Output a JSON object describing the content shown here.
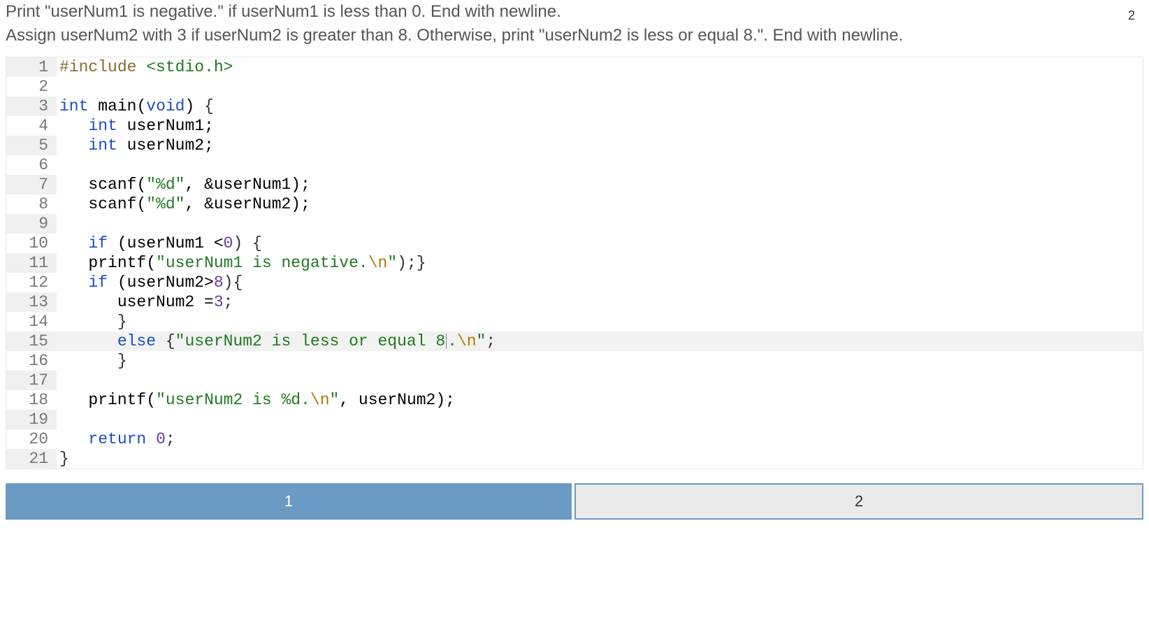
{
  "instructions": {
    "line1": "Print \"userNum1 is negative.\" if userNum1 is less than 0. End with newline.",
    "line2": "Assign userNum2 with 3 if userNum2 is greater than 8. Otherwise, print \"userNum2 is less or equal 8.\". End with newline."
  },
  "top_badge": "2",
  "code": {
    "lines": [
      {
        "n": "1",
        "shade": true,
        "highlight": false,
        "tokens": [
          {
            "t": "#include ",
            "c": "tok-preproc"
          },
          {
            "t": "<stdio.h>",
            "c": "tok-include"
          }
        ]
      },
      {
        "n": "2",
        "shade": false,
        "highlight": false,
        "tokens": []
      },
      {
        "n": "3",
        "shade": true,
        "highlight": false,
        "tokens": [
          {
            "t": "int",
            "c": "tok-type"
          },
          {
            "t": " ",
            "c": ""
          },
          {
            "t": "main",
            "c": "tok-func"
          },
          {
            "t": "(",
            "c": "tok-paren"
          },
          {
            "t": "void",
            "c": "tok-type"
          },
          {
            "t": ")",
            "c": "tok-paren"
          },
          {
            "t": " {",
            "c": "tok-op"
          }
        ]
      },
      {
        "n": "4",
        "shade": false,
        "highlight": false,
        "tokens": [
          {
            "t": "   ",
            "c": ""
          },
          {
            "t": "int",
            "c": "tok-type"
          },
          {
            "t": " userNum1;",
            "c": "tok-iden"
          }
        ]
      },
      {
        "n": "5",
        "shade": true,
        "highlight": false,
        "tokens": [
          {
            "t": "   ",
            "c": ""
          },
          {
            "t": "int",
            "c": "tok-type"
          },
          {
            "t": " userNum2;",
            "c": "tok-iden"
          }
        ]
      },
      {
        "n": "6",
        "shade": false,
        "highlight": false,
        "tokens": []
      },
      {
        "n": "7",
        "shade": true,
        "highlight": false,
        "tokens": [
          {
            "t": "   ",
            "c": ""
          },
          {
            "t": "scanf",
            "c": "tok-func"
          },
          {
            "t": "(",
            "c": "tok-paren"
          },
          {
            "t": "\"%d\"",
            "c": "tok-string"
          },
          {
            "t": ", &userNum1);",
            "c": "tok-iden"
          }
        ]
      },
      {
        "n": "8",
        "shade": false,
        "highlight": false,
        "tokens": [
          {
            "t": "   ",
            "c": ""
          },
          {
            "t": "scanf",
            "c": "tok-func"
          },
          {
            "t": "(",
            "c": "tok-paren"
          },
          {
            "t": "\"%d\"",
            "c": "tok-string"
          },
          {
            "t": ", &userNum2);",
            "c": "tok-iden"
          }
        ]
      },
      {
        "n": "9",
        "shade": true,
        "highlight": false,
        "tokens": []
      },
      {
        "n": "10",
        "shade": false,
        "highlight": false,
        "tokens": [
          {
            "t": "   ",
            "c": ""
          },
          {
            "t": "if",
            "c": "tok-keyword"
          },
          {
            "t": " (userNum1 <",
            "c": "tok-iden"
          },
          {
            "t": "0",
            "c": "tok-num"
          },
          {
            "t": ") {",
            "c": "tok-op"
          }
        ]
      },
      {
        "n": "11",
        "shade": true,
        "highlight": false,
        "tokens": [
          {
            "t": "   ",
            "c": ""
          },
          {
            "t": "printf",
            "c": "tok-func"
          },
          {
            "t": "(",
            "c": "tok-paren"
          },
          {
            "t": "\"userNum1 is negative.",
            "c": "tok-string"
          },
          {
            "t": "\\n",
            "c": "tok-esc"
          },
          {
            "t": "\"",
            "c": "tok-string"
          },
          {
            "t": ");}",
            "c": "tok-op"
          }
        ]
      },
      {
        "n": "12",
        "shade": false,
        "highlight": false,
        "tokens": [
          {
            "t": "   ",
            "c": ""
          },
          {
            "t": "if",
            "c": "tok-keyword"
          },
          {
            "t": " (userNum2>",
            "c": "tok-iden"
          },
          {
            "t": "8",
            "c": "tok-num"
          },
          {
            "t": "){",
            "c": "tok-op"
          }
        ]
      },
      {
        "n": "13",
        "shade": true,
        "highlight": false,
        "tokens": [
          {
            "t": "      userNum2 =",
            "c": "tok-iden"
          },
          {
            "t": "3",
            "c": "tok-num"
          },
          {
            "t": ";",
            "c": "tok-op"
          }
        ]
      },
      {
        "n": "14",
        "shade": false,
        "highlight": false,
        "tokens": [
          {
            "t": "      }",
            "c": "tok-op"
          }
        ]
      },
      {
        "n": "15",
        "shade": true,
        "highlight": true,
        "tokens": [
          {
            "t": "      ",
            "c": ""
          },
          {
            "t": "else",
            "c": "tok-keyword"
          },
          {
            "t": " {",
            "c": "tok-op"
          },
          {
            "t": "\"userNum2 is less or equal 8",
            "c": "tok-string"
          },
          {
            "cursor": true
          },
          {
            "t": ".",
            "c": "tok-string"
          },
          {
            "t": "\\n",
            "c": "tok-esc"
          },
          {
            "t": "\"",
            "c": "tok-string"
          },
          {
            "t": ";",
            "c": "tok-op"
          }
        ]
      },
      {
        "n": "16",
        "shade": false,
        "highlight": false,
        "tokens": [
          {
            "t": "      }",
            "c": "tok-op"
          }
        ]
      },
      {
        "n": "17",
        "shade": true,
        "highlight": false,
        "tokens": []
      },
      {
        "n": "18",
        "shade": false,
        "highlight": false,
        "tokens": [
          {
            "t": "   ",
            "c": ""
          },
          {
            "t": "printf",
            "c": "tok-func"
          },
          {
            "t": "(",
            "c": "tok-paren"
          },
          {
            "t": "\"userNum2 is %d.",
            "c": "tok-string"
          },
          {
            "t": "\\n",
            "c": "tok-esc"
          },
          {
            "t": "\"",
            "c": "tok-string"
          },
          {
            "t": ", userNum2);",
            "c": "tok-iden"
          }
        ]
      },
      {
        "n": "19",
        "shade": true,
        "highlight": false,
        "tokens": []
      },
      {
        "n": "20",
        "shade": false,
        "highlight": false,
        "tokens": [
          {
            "t": "   ",
            "c": ""
          },
          {
            "t": "return",
            "c": "tok-keyword"
          },
          {
            "t": " ",
            "c": ""
          },
          {
            "t": "0",
            "c": "tok-num"
          },
          {
            "t": ";",
            "c": "tok-op"
          }
        ]
      },
      {
        "n": "21",
        "shade": true,
        "highlight": false,
        "tokens": [
          {
            "t": "}",
            "c": "tok-op"
          }
        ]
      }
    ]
  },
  "tabs": {
    "tab1": "1",
    "tab2": "2"
  }
}
